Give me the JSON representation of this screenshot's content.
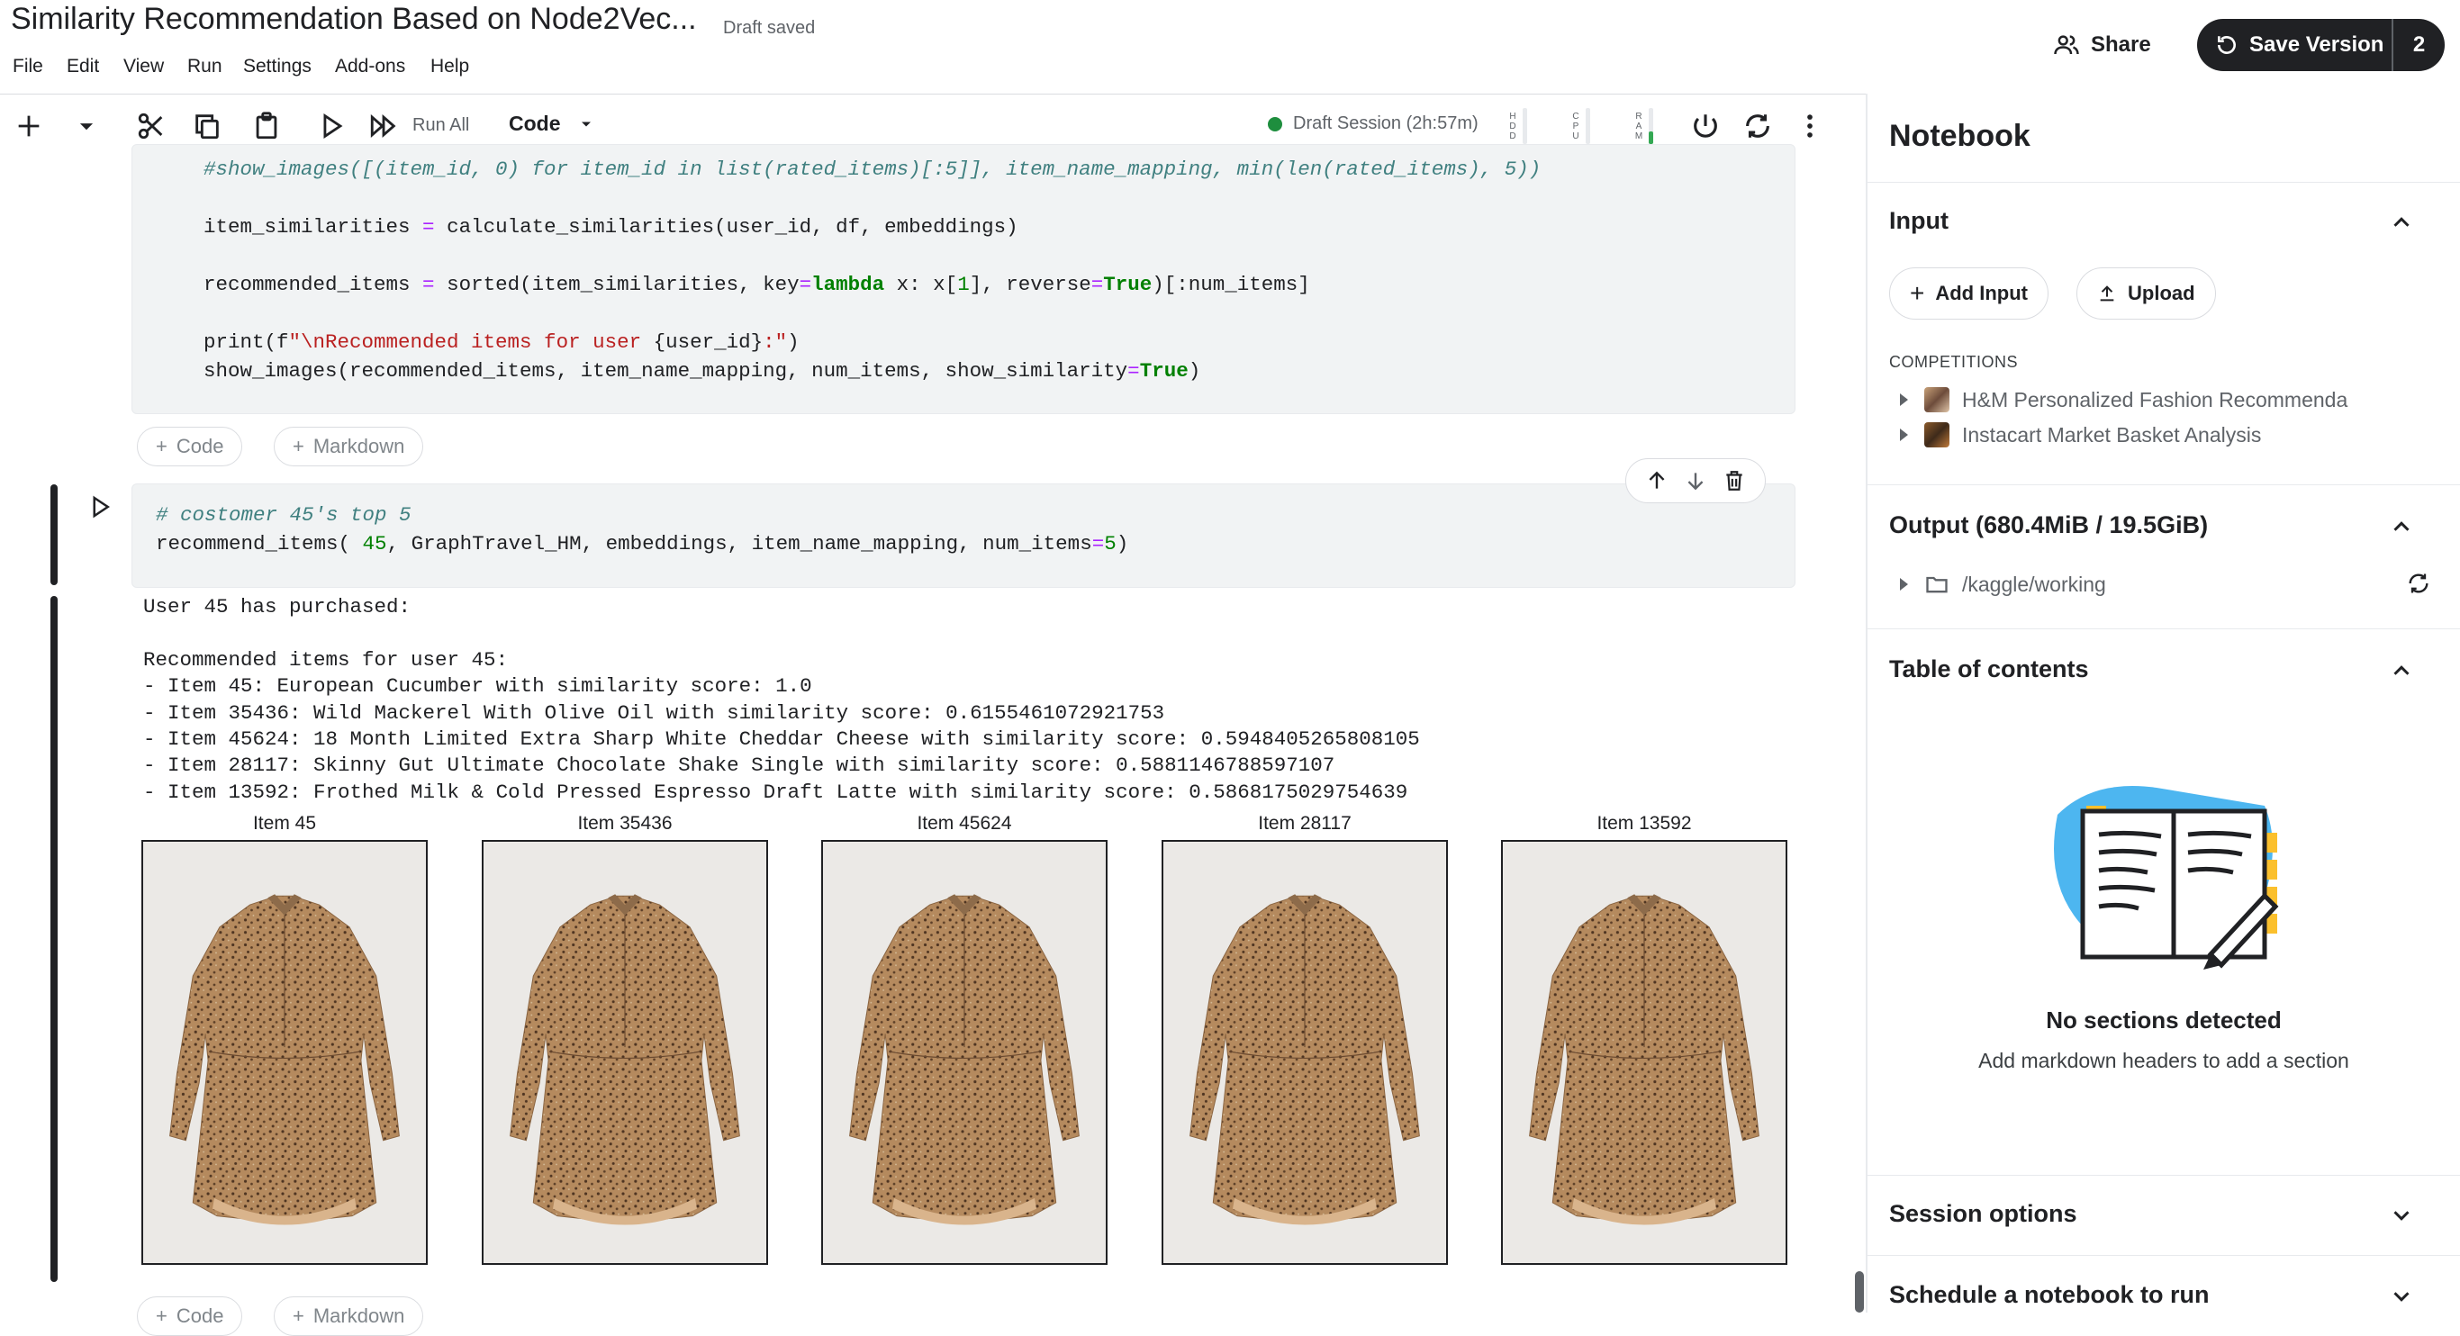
{
  "header": {
    "title": "Similarity Recommendation Based on Node2Vec...",
    "draft_status": "Draft saved",
    "share_label": "Share",
    "save_version_label": "Save Version",
    "save_version_count": "2"
  },
  "menu": [
    "File",
    "Edit",
    "View",
    "Run",
    "Settings",
    "Add-ons",
    "Help"
  ],
  "toolbar": {
    "run_all_label": "Run All",
    "cell_type": "Code",
    "session_label": "Draft Session (2h:57m)",
    "meters": [
      {
        "label": "HDD",
        "level": 0.0
      },
      {
        "label": "CPU",
        "level": 0.0
      },
      {
        "label": "RAM",
        "level": 0.35
      }
    ]
  },
  "cells": {
    "add_code_label": "Code",
    "add_markdown_label": "Markdown",
    "cell2_comment": "# costomer 45's top 5",
    "output_lines": [
      "User 45 has purchased:",
      "",
      "Recommended items for user 45:",
      "- Item 45: European Cucumber with similarity score: 1.0",
      "- Item 35436: Wild Mackerel With Olive Oil with similarity score: 0.6155461072921753",
      "- Item 45624: 18 Month Limited Extra Sharp White Cheddar Cheese with similarity score: 0.5948405265808105",
      "- Item 28117: Skinny Gut Ultimate Chocolate Shake Single with similarity score: 0.5881146788597107",
      "- Item 13592: Frothed Milk & Cold Pressed Espresso Draft Latte with similarity score: 0.5868175029754639"
    ],
    "image_titles": [
      "Item 45",
      "Item 35436",
      "Item 45624",
      "Item 28117",
      "Item 13592"
    ]
  },
  "panel": {
    "title": "Notebook",
    "input_section": "Input",
    "add_input_label": "Add Input",
    "upload_label": "Upload",
    "competitions_label": "COMPETITIONS",
    "competitions": [
      "H&M Personalized Fashion Recommenda",
      "Instacart Market Basket Analysis"
    ],
    "output_section": "Output (680.4MiB / 19.5GiB)",
    "output_path": "/kaggle/working",
    "toc_section": "Table of contents",
    "no_sections_title": "No sections detected",
    "no_sections_sub": "Add markdown headers to add a section",
    "session_options": "Session options",
    "schedule_label": "Schedule a notebook to run"
  },
  "colors": {
    "accent": "#202124",
    "session_dot": "#1e8e3e",
    "illustration_blue": "#4db6f0",
    "tab_yellow": "#fbc02d"
  }
}
